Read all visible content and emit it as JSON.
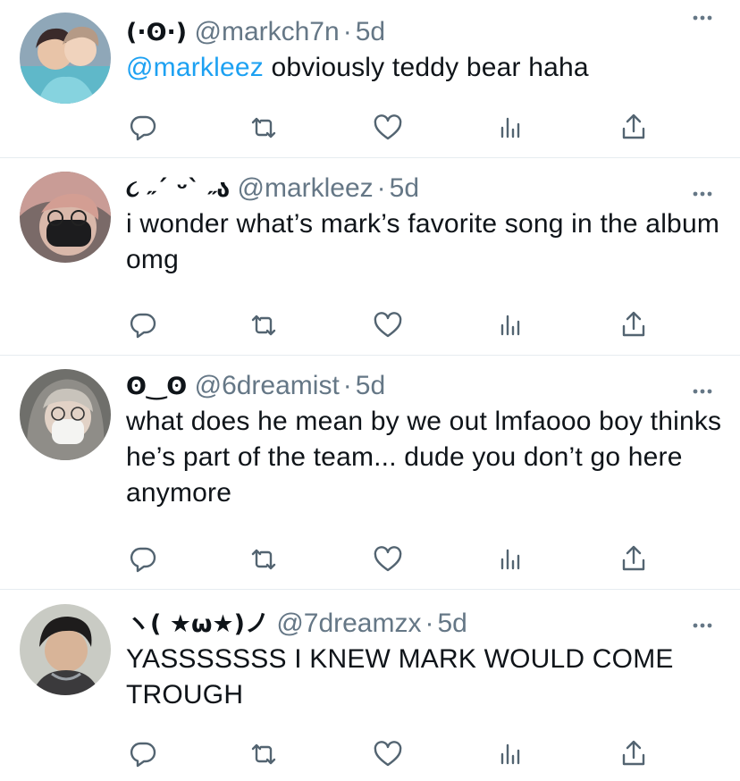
{
  "tweets": [
    {
      "name": "(·ʘ·)",
      "handle": "@markch7n",
      "separator": "·",
      "time": "5d",
      "reply_to": "@markleez",
      "text": " obviously teddy bear haha"
    },
    {
      "name": "૮ ˶´ ᵕˋ ˶ა",
      "handle": "@markleez",
      "separator": "·",
      "time": "5d",
      "text": "i wonder what’s mark’s favorite song in the album omg"
    },
    {
      "name": "ʘ‿ʘ",
      "handle": "@6dreamist",
      "separator": "·",
      "time": "5d",
      "text": "what does he mean by we out lmfaooo boy thinks he’s part of the team... dude you don’t go here anymore"
    },
    {
      "name": "ヽ( ★ω★)ノ",
      "handle": "@7dreamzx",
      "separator": "·",
      "time": "5d",
      "text": "YASSSSSSS I KNEW MARK WOULD COME TROUGH"
    }
  ],
  "icons": {
    "reply": "reply-icon",
    "retweet": "retweet-icon",
    "like": "heart-icon",
    "analytics": "analytics-icon",
    "share": "share-icon",
    "more": "more-icon"
  },
  "colors": {
    "mention": "#1da1f2",
    "secondary_text": "#657786",
    "icon": "#536471",
    "divider": "#e6ecf0"
  }
}
